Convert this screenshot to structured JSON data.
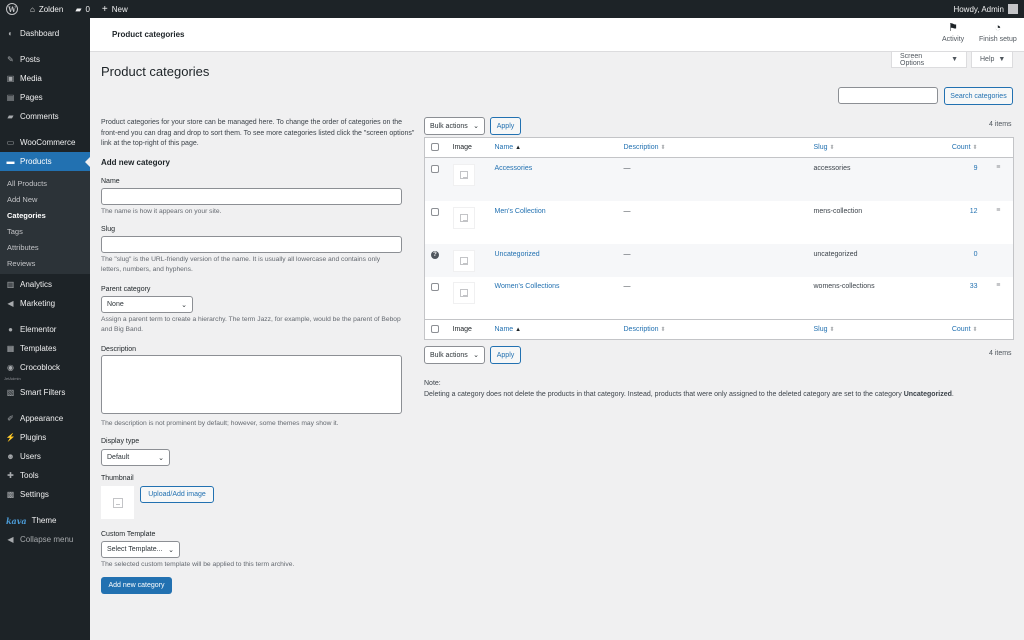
{
  "adminbar": {
    "site_name": "Zolden",
    "comments_count": "0",
    "new_label": "New",
    "greeting": "Howdy, Admin"
  },
  "sidebar": {
    "dashboard": "Dashboard",
    "posts": "Posts",
    "media": "Media",
    "pages": "Pages",
    "comments": "Comments",
    "woocommerce": "WooCommerce",
    "products": "Products",
    "products_sub": [
      "All Products",
      "Add New",
      "Categories",
      "Tags",
      "Attributes",
      "Reviews"
    ],
    "analytics": "Analytics",
    "marketing": "Marketing",
    "elementor": "Elementor",
    "templates": "Templates",
    "crocoblock": "Crocoblock",
    "jet_label": "JetAdmin",
    "smart_filters": "Smart Filters",
    "appearance": "Appearance",
    "plugins": "Plugins",
    "users": "Users",
    "tools": "Tools",
    "settings": "Settings",
    "theme_logo": "kava",
    "theme": "Theme",
    "collapse": "Collapse menu"
  },
  "header": {
    "breadcrumb": "Product categories",
    "activity": "Activity",
    "finish_setup": "Finish setup",
    "screen_options": "Screen Options",
    "help": "Help"
  },
  "page_title": "Product categories",
  "search": {
    "placeholder": "",
    "button": "Search categories"
  },
  "form": {
    "intro": "Product categories for your store can be managed here. To change the order of categories on the front-end you can drag and drop to sort them. To see more categories listed click the \"screen options\" link at the top-right of this page.",
    "heading": "Add new category",
    "name_label": "Name",
    "name_help": "The name is how it appears on your site.",
    "slug_label": "Slug",
    "slug_help": "The \"slug\" is the URL-friendly version of the name. It is usually all lowercase and contains only letters, numbers, and hyphens.",
    "parent_label": "Parent category",
    "parent_value": "None",
    "parent_help": "Assign a parent term to create a hierarchy. The term Jazz, for example, would be the parent of Bebop and Big Band.",
    "description_label": "Description",
    "description_help": "The description is not prominent by default; however, some themes may show it.",
    "display_label": "Display type",
    "display_value": "Default",
    "thumbnail_label": "Thumbnail",
    "upload_button": "Upload/Add image",
    "template_label": "Custom Template",
    "template_value": "Select Template...",
    "template_help": "The selected custom template will be applied to this term archive.",
    "submit": "Add new category"
  },
  "table": {
    "bulk_actions": "Bulk actions",
    "apply": "Apply",
    "items_count": "4 items",
    "columns": {
      "image": "Image",
      "name": "Name",
      "description": "Description",
      "slug": "Slug",
      "count": "Count"
    },
    "rows": [
      {
        "name": "Accessories",
        "description": "—",
        "slug": "accessories",
        "count": "9"
      },
      {
        "name": "Men's Collection",
        "description": "—",
        "slug": "mens-collection",
        "count": "12"
      },
      {
        "name": "Uncategorized",
        "description": "—",
        "slug": "uncategorized",
        "count": "0"
      },
      {
        "name": "Women's Collections",
        "description": "—",
        "slug": "womens-collections",
        "count": "33"
      }
    ]
  },
  "note": {
    "title": "Note:",
    "text": "Deleting a category does not delete the products in that category. Instead, products that were only assigned to the deleted category are set to the category",
    "emphasis": "Uncategorized"
  },
  "colors": {
    "admin_bar": "#1d2327",
    "accent": "#2271b1",
    "background": "#f0f0f1"
  }
}
